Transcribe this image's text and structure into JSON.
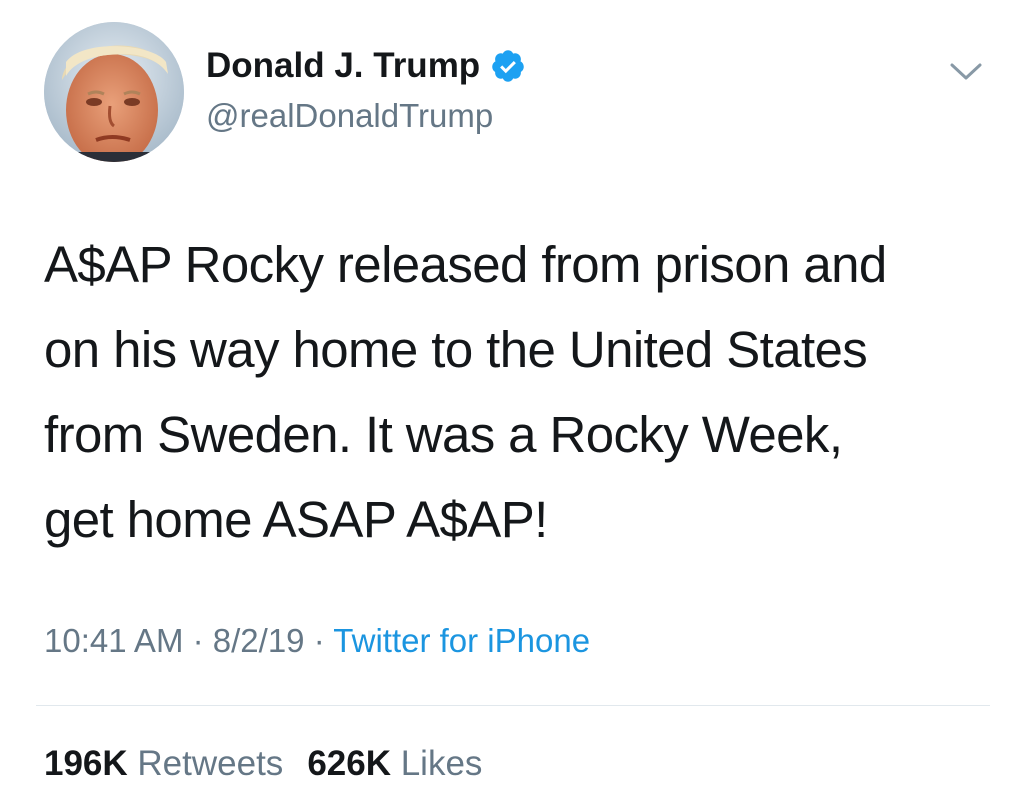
{
  "author": {
    "display_name": "Donald J. Trump",
    "handle": "@realDonaldTrump",
    "verified": true,
    "verified_color": "#1da1f2"
  },
  "tweet": {
    "text": "A$AP Rocky released from prison and\non his way home to the United States\nfrom Sweden. It was a Rocky Week,\nget home ASAP A$AP!",
    "time": "10:41 AM",
    "date": "8/2/19",
    "separator": "·",
    "source": "Twitter for iPhone"
  },
  "stats": {
    "retweets_count": "196K",
    "retweets_label": "Retweets",
    "likes_count": "626K",
    "likes_label": "Likes"
  },
  "icons": {
    "avatar": "profile-photo",
    "verified": "verified-badge-icon",
    "menu": "chevron-down-icon"
  },
  "colors": {
    "text": "#14171a",
    "secondary": "#657786",
    "link": "#1b95e0",
    "divider": "#e1e8ed"
  }
}
